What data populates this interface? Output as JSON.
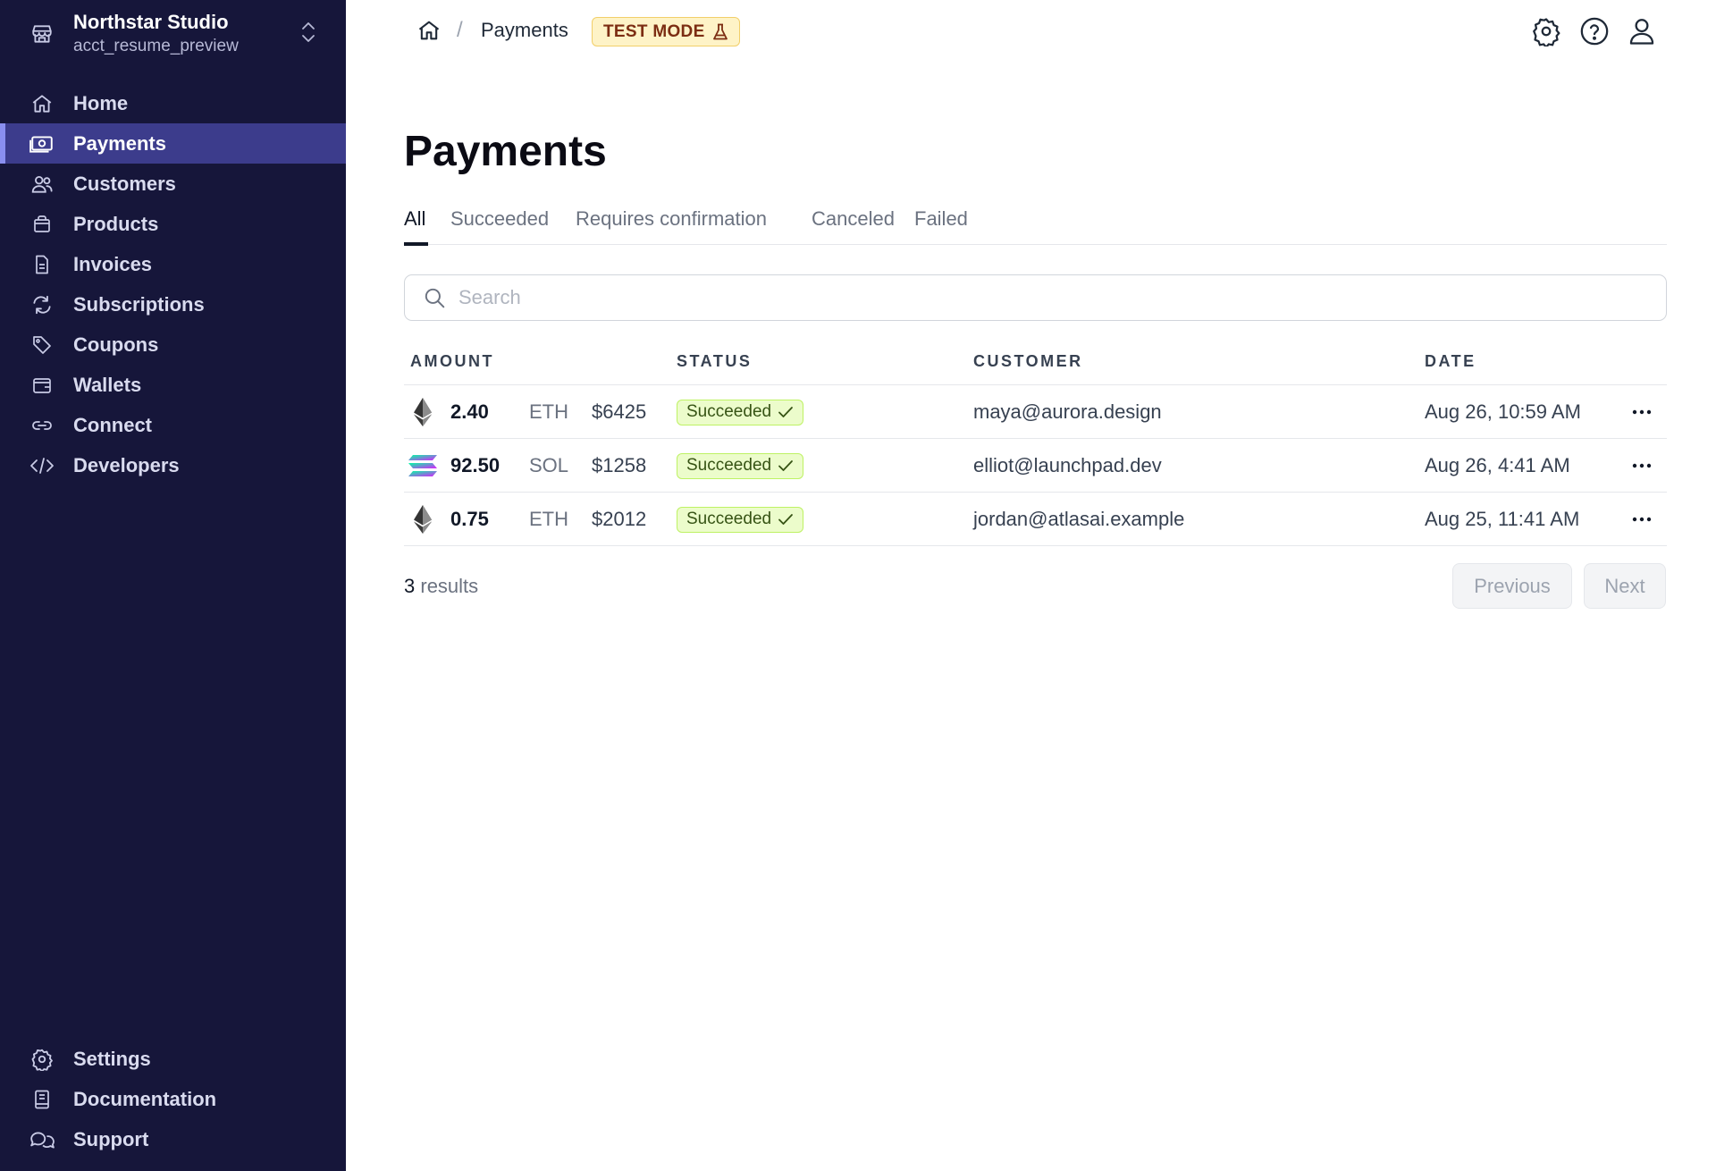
{
  "account": {
    "name": "Northstar Studio",
    "id": "acct_resume_preview"
  },
  "sidebar": {
    "items": [
      {
        "label": "Home",
        "icon": "home-icon"
      },
      {
        "label": "Payments",
        "icon": "payments-icon",
        "active": true
      },
      {
        "label": "Customers",
        "icon": "customers-icon"
      },
      {
        "label": "Products",
        "icon": "products-icon"
      },
      {
        "label": "Invoices",
        "icon": "invoices-icon"
      },
      {
        "label": "Subscriptions",
        "icon": "subscriptions-icon"
      },
      {
        "label": "Coupons",
        "icon": "coupons-icon"
      },
      {
        "label": "Wallets",
        "icon": "wallets-icon"
      },
      {
        "label": "Connect",
        "icon": "connect-icon"
      },
      {
        "label": "Developers",
        "icon": "developers-icon"
      }
    ],
    "bottom_items": [
      {
        "label": "Settings",
        "icon": "settings-icon"
      },
      {
        "label": "Documentation",
        "icon": "documentation-icon"
      },
      {
        "label": "Support",
        "icon": "support-icon"
      }
    ]
  },
  "header": {
    "breadcrumb_separator": "/",
    "breadcrumb_page": "Payments",
    "test_mode_label": "TEST MODE",
    "icons": [
      "settings-icon",
      "help-icon",
      "user-icon"
    ]
  },
  "main": {
    "title": "Payments",
    "tabs": [
      {
        "label": "All",
        "active": true
      },
      {
        "label": "Succeeded"
      },
      {
        "label": "Requires confirmation"
      },
      {
        "label": "Canceled"
      },
      {
        "label": "Failed"
      }
    ],
    "search": {
      "placeholder": "Search",
      "value": ""
    },
    "table": {
      "columns": [
        "AMOUNT",
        "STATUS",
        "CUSTOMER",
        "DATE"
      ],
      "rows": [
        {
          "coin": "eth",
          "amount": "2.40",
          "currency": "ETH",
          "usd": "$6425",
          "status": "Succeeded",
          "customer": "maya@aurora.design",
          "date": "Aug 26, 10:59 AM"
        },
        {
          "coin": "sol",
          "amount": "92.50",
          "currency": "SOL",
          "usd": "$1258",
          "status": "Succeeded",
          "customer": "elliot@launchpad.dev",
          "date": "Aug 26, 4:41 AM"
        },
        {
          "coin": "eth",
          "amount": "0.75",
          "currency": "ETH",
          "usd": "$2012",
          "status": "Succeeded",
          "customer": "jordan@atlasai.example",
          "date": "Aug 25, 11:41 AM"
        }
      ]
    },
    "results_count": "3",
    "results_label": "results",
    "pagination": {
      "previous": "Previous",
      "next": "Next"
    }
  },
  "colors": {
    "sidebar_bg": "#16163a",
    "sidebar_active": "#3c3c8c",
    "status_success_bg": "#ecfccb",
    "status_success_text": "#365314",
    "test_mode_bg": "#fef3c7"
  }
}
